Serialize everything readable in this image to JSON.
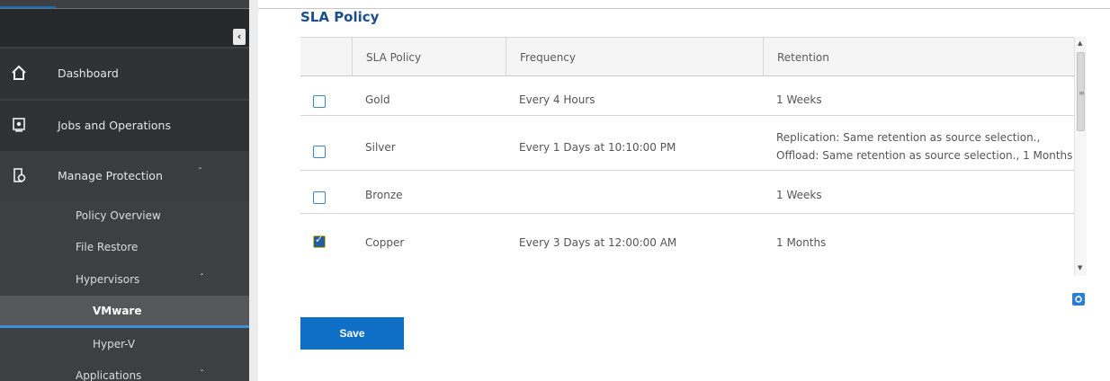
{
  "sidebar": {
    "collapse_icon": "chevron-left-icon",
    "items": [
      {
        "label": "Dashboard",
        "icon": "home-icon"
      },
      {
        "label": "Jobs and Operations",
        "icon": "monitor-icon"
      },
      {
        "label": "Manage Protection",
        "icon": "protection-icon"
      }
    ],
    "manage_protection_children": [
      {
        "label": "Policy Overview"
      },
      {
        "label": "File Restore"
      },
      {
        "label": "Hypervisors"
      }
    ],
    "hypervisor_children": [
      {
        "label": "VMware"
      },
      {
        "label": "Hyper-V"
      }
    ],
    "applications_label": "Applications"
  },
  "main": {
    "title": "SLA Policy",
    "table": {
      "columns": [
        "SLA Policy",
        "Frequency",
        "Retention"
      ],
      "rows": [
        {
          "policy": "Gold",
          "frequency": "Every 4 Hours",
          "retention_line1": "1 Weeks",
          "retention_line2": "",
          "checked": false
        },
        {
          "policy": "Silver",
          "frequency": "Every 1 Days at 10:10:00 PM",
          "retention_line1": "Replication: Same retention as source selection.,",
          "retention_line2": "Offload: Same retention as source selection., 1 Months",
          "checked": false
        },
        {
          "policy": "Bronze",
          "frequency": "",
          "retention_line1": "1 Weeks",
          "retention_line2": "",
          "checked": false
        },
        {
          "policy": "Copper",
          "frequency": "Every 3 Days at 12:00:00 AM",
          "retention_line1": "1 Months",
          "retention_line2": "",
          "checked": true
        }
      ]
    },
    "save_label": "Save"
  },
  "colors": {
    "accent": "#0f6fc7",
    "title": "#1b4e8c",
    "sidebar": "#3d3f41"
  }
}
